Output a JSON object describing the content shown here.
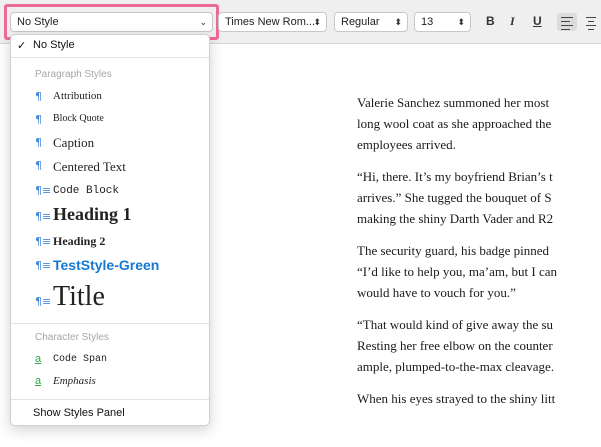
{
  "toolbar": {
    "style_value": "No Style",
    "font_value": "Times New Rom...",
    "weight_value": "Regular",
    "size_value": "13",
    "bold_label": "B",
    "italic_label": "I",
    "underline_label": "U"
  },
  "icons": {
    "dropdown_arrow": "chevron-down-icon",
    "stepper": "up-down-chevron-icon",
    "paragraph": "pilcrow-icon",
    "character": "character-style-icon",
    "align_left": "align-left-icon",
    "align_center": "align-center-icon"
  },
  "colors": {
    "highlight": "#ec6b94",
    "paragraph_icon": "#4a8ad8",
    "character_icon": "#2fa54a",
    "teststyle_green": "#1678d2"
  },
  "dropdown": {
    "checked": {
      "mark": "✓",
      "label": "No Style"
    },
    "paragraph_header": "Paragraph Styles",
    "paragraph_styles": [
      {
        "label": "Attribution"
      },
      {
        "label": "Block Quote"
      },
      {
        "label": "Caption"
      },
      {
        "label": "Centered Text"
      },
      {
        "label": "Code Block"
      },
      {
        "label": "Heading 1"
      },
      {
        "label": "Heading 2"
      },
      {
        "label": "TestStyle-Green"
      },
      {
        "label": "Title"
      }
    ],
    "character_header": "Character Styles",
    "character_styles": [
      {
        "label": "Code Span"
      },
      {
        "label": "Emphasis"
      }
    ],
    "footer": "Show Styles Panel"
  },
  "document": {
    "paragraphs": [
      [
        "Valerie Sanchez summoned her most",
        "long wool coat as she approached the",
        "employees arrived."
      ],
      [
        "“Hi, there. It’s my boyfriend Brian’s t",
        "arrives.” She tugged the bouquet of S",
        "making the shiny Darth Vader and R2"
      ],
      [
        "The security guard, his badge pinned",
        "“I’d like to help you, ma’am, but I can",
        "would have to vouch for you.”"
      ],
      [
        "“That would kind of give away the su",
        "Resting her free elbow on the counter",
        "ample, plumped-to-the-max cleavage."
      ],
      [
        "When his eyes strayed to the shiny litt"
      ]
    ]
  }
}
